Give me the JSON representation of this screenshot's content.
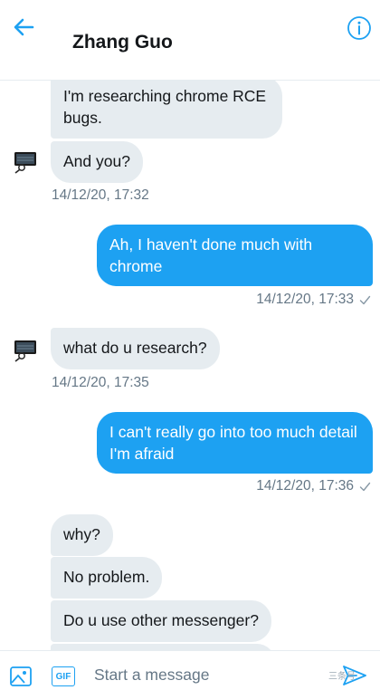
{
  "header": {
    "title": "Zhang Guo",
    "back_icon": "arrow-left-icon",
    "info_icon": "info-icon"
  },
  "messages": [
    {
      "direction": "in",
      "text": "I'm researching chrome RCE\nbugs."
    },
    {
      "direction": "in",
      "text": "And you?",
      "timestamp": "14/12/20, 17:32"
    },
    {
      "direction": "out",
      "text": "Ah, I haven't done much with chrome",
      "timestamp": "14/12/20, 17:33",
      "read_icon": "checkmark-icon"
    },
    {
      "direction": "in",
      "text": "what do u research?",
      "timestamp": "14/12/20, 17:35"
    },
    {
      "direction": "out",
      "text": "I can't really go into too much detail I'm afraid",
      "timestamp": "14/12/20, 17:36",
      "read_icon": "checkmark-icon"
    },
    {
      "direction": "in",
      "text": "why?"
    },
    {
      "direction": "in",
      "text": "No problem."
    },
    {
      "direction": "in",
      "text": "Do u use other messenger?"
    }
  ],
  "composer": {
    "placeholder": "Start a message",
    "value": "",
    "gif_label": "GIF",
    "media_icon": "image-icon",
    "send_icon": "send-icon"
  },
  "watermark": {
    "text": "三条号"
  },
  "colors": {
    "accent": "#1da1f2",
    "incoming_bubble": "#e6ecf0",
    "secondary_text": "#657786"
  }
}
